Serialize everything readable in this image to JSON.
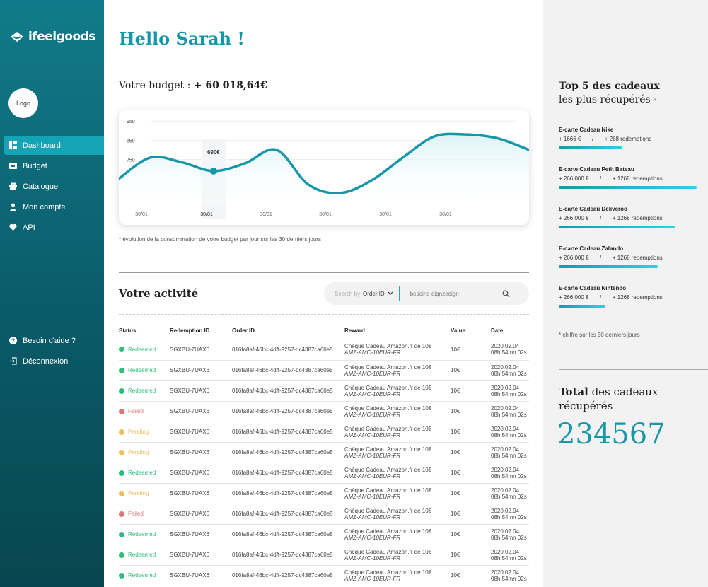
{
  "brand": {
    "name": "ifeelgoods",
    "logo_placeholder": "Logo"
  },
  "nav": {
    "items": [
      {
        "label": "Dashboard",
        "icon": "dashboard-icon",
        "active": true
      },
      {
        "label": "Budget",
        "icon": "wallet-icon"
      },
      {
        "label": "Catalogue",
        "icon": "gift-icon"
      },
      {
        "label": "Mon compte",
        "icon": "user-icon"
      },
      {
        "label": "API",
        "icon": "heart-icon"
      }
    ],
    "help": "Besoin d'aide ?",
    "logout": "Déconnexion"
  },
  "greeting": {
    "prefix": "Hello ",
    "name": "Sarah !"
  },
  "budget": {
    "label": "Votre budget : ",
    "value": "+ 60 018,64€"
  },
  "chart_data": {
    "type": "area",
    "y_ticks": [
      "950",
      "850",
      "750"
    ],
    "x_labels": [
      "30/01",
      "30/01",
      "30/01",
      "30/01",
      "30/01",
      "30/01"
    ],
    "highlight": {
      "label": "690€",
      "x_label": "30/01",
      "value": 690
    },
    "points_x": [
      0,
      0.5,
      1,
      1.5,
      2,
      2.5,
      3,
      3.5,
      4,
      4.5,
      5,
      5.5,
      6,
      6.5
    ],
    "points_y": [
      650,
      760,
      735,
      690,
      730,
      800,
      620,
      575,
      640,
      760,
      870,
      880,
      860,
      800
    ],
    "ylim": [
      520,
      980
    ],
    "color": "#1597a8",
    "note": "* évolution de la consommation de votre budget par jour sur les 30 derniers jours"
  },
  "activity": {
    "title": "Votre activité",
    "search": {
      "by_label": "Search by",
      "selected": "Order ID",
      "placeholder": "besoins-oiqnzeoign"
    },
    "columns": [
      "Status",
      "Redemption ID",
      "Order ID",
      "Reward",
      "Value",
      "Date"
    ],
    "status_colors": {
      "Redeemed": "#2fbf7a",
      "Failed": "#e57373",
      "Pending": "#f0bc5e"
    },
    "rows": [
      {
        "status": "Redeemed",
        "redemption": "SGXBU-7UAX6",
        "order": "016fa8af-46bc-4dff-9257-dc4387ca60e5",
        "reward": "Chèque Cadeau Amazon.fr de 10€",
        "code": "AMZ-AMC-10EUR-FR",
        "value": "10€",
        "date": "2020.02.04",
        "time": "08h 54mn 02s"
      },
      {
        "status": "Redeemed",
        "redemption": "SGXBU-7UAX6",
        "order": "016fa8af-46bc-4dff-9257-dc4387ca60e5",
        "reward": "Chèque Cadeau Amazon.fr de 10€",
        "code": "AMZ-AMC-10EUR-FR",
        "value": "10€",
        "date": "2020.02.04",
        "time": "08h 54mn 02s"
      },
      {
        "status": "Redeemed",
        "redemption": "SGXBU-7UAX6",
        "order": "016fa8af-46bc-4dff-9257-dc4387ca60e5",
        "reward": "Chèque Cadeau Amazon.fr de 10€",
        "code": "AMZ-AMC-10EUR-FR",
        "value": "10€",
        "date": "2020.02.04",
        "time": "08h 54mn 02s"
      },
      {
        "status": "Failed",
        "redemption": "SGXBU-7UAX6",
        "order": "016fa8af-46bc-4dff-9257-dc4387ca60e5",
        "reward": "Chèque Cadeau Amazon.fr de 10€",
        "code": "AMZ-AMC-10EUR-FR",
        "value": "10€",
        "date": "2020.02.04",
        "time": "08h 54mn 02s"
      },
      {
        "status": "Pending",
        "redemption": "SGXBU-7UAX6",
        "order": "016fa8af-46bc-4dff-9257-dc4387ca60e5",
        "reward": "Chèque Cadeau Amazon.fr de 10€",
        "code": "AMZ-AMC-10EUR-FR",
        "value": "10€",
        "date": "2020.02.04",
        "time": "08h 54mn 02s"
      },
      {
        "status": "Pending",
        "redemption": "SGXBU-7UAX6",
        "order": "016fa8af-46bc-4dff-9257-dc4387ca60e5",
        "reward": "Chèque Cadeau Amazon.fr de 10€",
        "code": "AMZ-AMC-10EUR-FR",
        "value": "10€",
        "date": "2020.02.04",
        "time": "08h 54mn 02s"
      },
      {
        "status": "Redeemed",
        "redemption": "SGXBU-7UAX6",
        "order": "016fa8af-46bc-4dff-9257-dc4387ca60e5",
        "reward": "Chèque Cadeau Amazon.fr de 10€",
        "code": "AMZ-AMC-10EUR-FR",
        "value": "10€",
        "date": "2020.02.04",
        "time": "08h 54mn 02s"
      },
      {
        "status": "Pending",
        "redemption": "SGXBU-7UAX6",
        "order": "016fa8af-46bc-4dff-9257-dc4387ca60e5",
        "reward": "Chèque Cadeau Amazon.fr de 10€",
        "code": "AMZ-AMC-10EUR-FR",
        "value": "10€",
        "date": "2020.02.04",
        "time": "08h 54mn 02s"
      },
      {
        "status": "Failed",
        "redemption": "SGXBU-7UAX6",
        "order": "016fa8af-46bc-4dff-9257-dc4387ca60e5",
        "reward": "Chèque Cadeau Amazon.fr de 10€",
        "code": "AMZ-AMC-10EUR-FR",
        "value": "10€",
        "date": "2020.02.04",
        "time": "08h 54mn 02s"
      },
      {
        "status": "Redeemed",
        "redemption": "SGXBU-7UAX6",
        "order": "016fa8af-46bc-4dff-9257-dc4387ca60e5",
        "reward": "Chèque Cadeau Amazon.fr de 10€",
        "code": "AMZ-AMC-10EUR-FR",
        "value": "10€",
        "date": "2020.02.04",
        "time": "08h 54mn 02s"
      },
      {
        "status": "Redeemed",
        "redemption": "SGXBU-7UAX6",
        "order": "016fa8af-46bc-4dff-9257-dc4387ca60e5",
        "reward": "Chèque Cadeau Amazon.fr de 10€",
        "code": "AMZ-AMC-10EUR-FR",
        "value": "10€",
        "date": "2020.02.04",
        "time": "08h 54mn 02s"
      },
      {
        "status": "Redeemed",
        "redemption": "SGXBU-7UAX6",
        "order": "016fa8af-46bc-4dff-9257-dc4387ca60e5",
        "reward": "Chèque Cadeau Amazon.fr de 10€",
        "code": "AMZ-AMC-10EUR-FR",
        "value": "10€",
        "date": "2020.02.04",
        "time": "08h 54mn 02s"
      }
    ]
  },
  "top5": {
    "title_bold": "Top 5 des cadeaux",
    "title_rest": "les plus récupérés",
    "star": "*",
    "items": [
      {
        "name": "E-carte Cadeau Nike",
        "amount": "+ 1666 €",
        "sep": "/",
        "redemptions": "+ 268 redemptions",
        "fill": 0.46
      },
      {
        "name": "E-carte Cadeau Petit Bateau",
        "amount": "+ 266 000 €",
        "sep": "/",
        "redemptions": "+ 1268 redemptions",
        "fill": 1.0
      },
      {
        "name": "E-carte Cadeau Deliveroo",
        "amount": "+ 266 000 €",
        "sep": "/",
        "redemptions": "+ 1268 redemptions",
        "fill": 0.84
      },
      {
        "name": "E-carte Cadeau Zalando",
        "amount": "+ 266 000 €",
        "sep": "/",
        "redemptions": "+ 1268 redemptions",
        "fill": 0.72
      },
      {
        "name": "E-carte Cadeau Nintendo",
        "amount": "+ 266 000 €",
        "sep": "/",
        "redemptions": "+ 1268 redemptions",
        "fill": 0.34
      }
    ],
    "note": "* chiffre sur les 30 derniers jours"
  },
  "total": {
    "bold": "Total",
    "rest": " des cadeaux récupérés",
    "value": "234567"
  }
}
